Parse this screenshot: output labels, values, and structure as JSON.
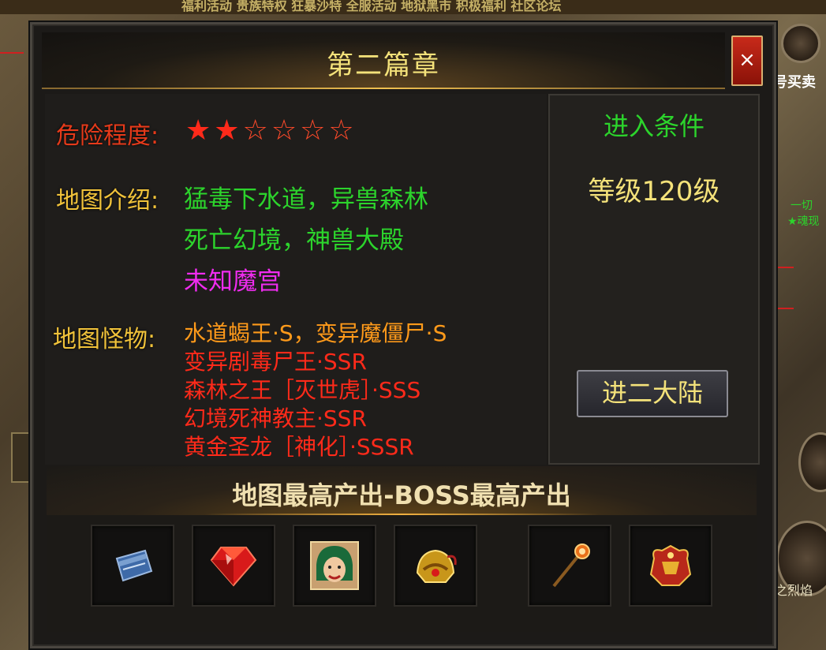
{
  "dialog": {
    "title": "第二篇章",
    "close_label": "×"
  },
  "danger": {
    "label": "危险程度:",
    "rating": 2,
    "max_rating": 6,
    "filled_star": "★★",
    "empty_star": "☆☆☆☆"
  },
  "intro": {
    "label": "地图介绍:",
    "lines": [
      {
        "text": "猛毒下水道，异兽森林",
        "color": "#2cd42c"
      },
      {
        "text": "死亡幻境，神兽大殿",
        "color": "#2cd42c"
      },
      {
        "text": "未知魔宫",
        "color": "#f02cf0"
      }
    ]
  },
  "monsters": {
    "label": "地图怪物:",
    "items": [
      {
        "text": "水道蝎王·S，变异魔僵尸·S",
        "color": "#ff9a1a"
      },
      {
        "text": "变异剧毒尸王·SSR",
        "color": "#ff2a1a"
      },
      {
        "text": "森林之王［灭世虎］·SSS",
        "color": "#ff2a1a"
      },
      {
        "text": "幻境死神教主·SSR",
        "color": "#ff2a1a"
      },
      {
        "text": "黄金圣龙［神化］·SSSR",
        "color": "#ff2a1a"
      }
    ]
  },
  "requirements": {
    "title": "进入条件",
    "level": "等级120级",
    "enter_button": "进二大陆"
  },
  "drops": {
    "title": "地图最高产出-BOSS最高产出",
    "items": [
      {
        "icon": "skill-book-icon"
      },
      {
        "icon": "red-gem-icon"
      },
      {
        "icon": "hero-portrait-icon"
      },
      {
        "icon": "golden-helmet-icon"
      },
      {
        "icon": "fire-staff-icon"
      },
      {
        "icon": "dragon-armor-icon"
      }
    ]
  },
  "background": {
    "top_strip": "福利活动  贵族特权  狂暴沙特  全服活动  地狱黑市  积极福利  社区论坛",
    "right_text_1": "号买卖",
    "right_text_2": "一切",
    "right_text_3": "★魂现",
    "right_text_4": "之烈焰"
  }
}
